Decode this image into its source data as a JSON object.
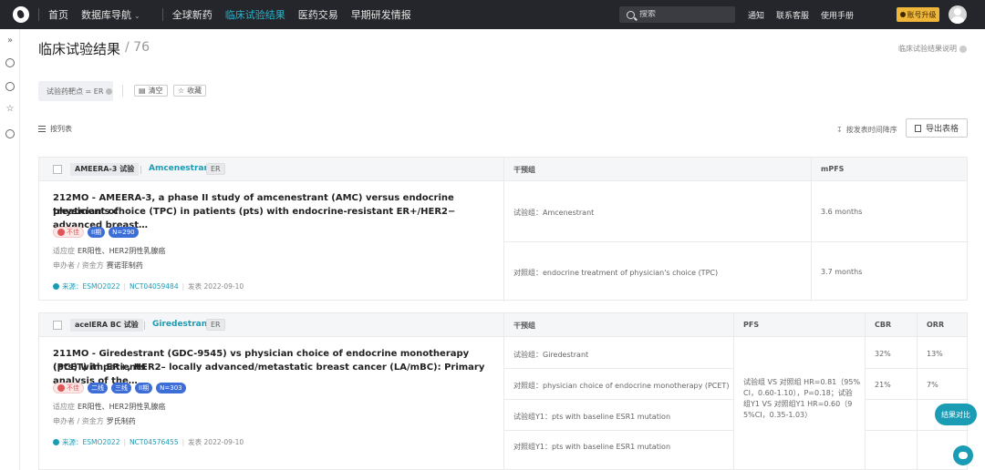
{
  "nav": {
    "items": [
      "首页",
      "数据库导航",
      "全球新药",
      "临床试验结果",
      "医药交易",
      "早期研发情报"
    ],
    "active_index": 3,
    "search_placeholder": "搜索",
    "right_items": [
      "通知",
      "联系客服",
      "使用手册"
    ],
    "upgrade_label": "账号升级"
  },
  "page": {
    "title": "临床试验结果",
    "count": "/ 76",
    "help_link": "临床试验结果说明"
  },
  "filters": {
    "tag": "试验药靶点 = ER",
    "clear_label": "清空",
    "save_label": "收藏"
  },
  "toolbar": {
    "view_label": "按列表",
    "sort_label": "按发表时间降序",
    "export_label": "导出表格"
  },
  "results": [
    {
      "trial": "AMEERA-3 试验",
      "drug": "Amcenestrant",
      "target": "ER",
      "title_line1": "212MO - AMEERA-3, a phase II study of amcenestrant (AMC) versus endocrine treatment of",
      "title_line2": "physician's choice (TPC) in patients (pts) with endocrine-resistant ER+/HER2− advanced breast…",
      "tags": [
        "不佳",
        "II期",
        "N=290"
      ],
      "indication_label": "适应症",
      "indication": "ER阳性、HER2阴性乳腺癌",
      "sponsor_label": "申办者 / 资金方",
      "sponsor": "赛诺菲制药",
      "source": "来源：ESMO2022",
      "nct": "NCT04059484",
      "published": "发表 2022-09-10",
      "columns": [
        "干预组",
        "mPFS"
      ],
      "rows": [
        {
          "group": "试验组：Amcenestrant",
          "mpfs": "3.6 months"
        },
        {
          "group": "对照组：endocrine treatment of physician's choice (TPC)",
          "mpfs": "3.7 months"
        }
      ]
    },
    {
      "trial": "acelERA BC 试验",
      "drug": "Giredestrant",
      "target": "ER",
      "title_line1": "211MO - Giredestrant (GDC-9545) vs physician choice of endocrine monotherapy (PCET) in patients",
      "title_line2": "(pts) with ER+, HER2– locally advanced/metastatic breast cancer (LA/mBC): Primary analysis of the…",
      "tags": [
        "不佳",
        "二线",
        "三线",
        "II期",
        "N=303"
      ],
      "indication_label": "适应症",
      "indication": "ER阳性、HER2阴性乳腺癌",
      "sponsor_label": "申办者 / 资金方",
      "sponsor": "罗氏制药",
      "source": "来源：ESMO2022",
      "nct": "NCT04576455",
      "published": "发表 2022-09-10",
      "columns": [
        "干预组",
        "PFS",
        "CBR",
        "ORR"
      ],
      "rows": [
        {
          "group": "试验组：Giredestrant",
          "cbr": "32%",
          "orr": "13%"
        },
        {
          "group": "对照组：physician choice of endocrine monotherapy (PCET)",
          "cbr": "21%",
          "orr": "7%"
        },
        {
          "group": "试验组Y1：pts with baseline ESR1 mutation",
          "cbr": "",
          "orr": ""
        },
        {
          "group": "对照组Y1：pts with baseline ESR1 mutation",
          "cbr": "",
          "orr": ""
        }
      ],
      "pfs_text_1": "试验组 VS 对照组 HR=0.81（95%",
      "pfs_text_2": "CI，0.60-1.10），P=0.18；试验",
      "pfs_text_3": "组Y1 VS 对照组Y1 HR=0.60（9",
      "pfs_text_4": "5%CI，0.35-1.03）"
    }
  ],
  "floating": {
    "compare_label": "结果对比"
  }
}
